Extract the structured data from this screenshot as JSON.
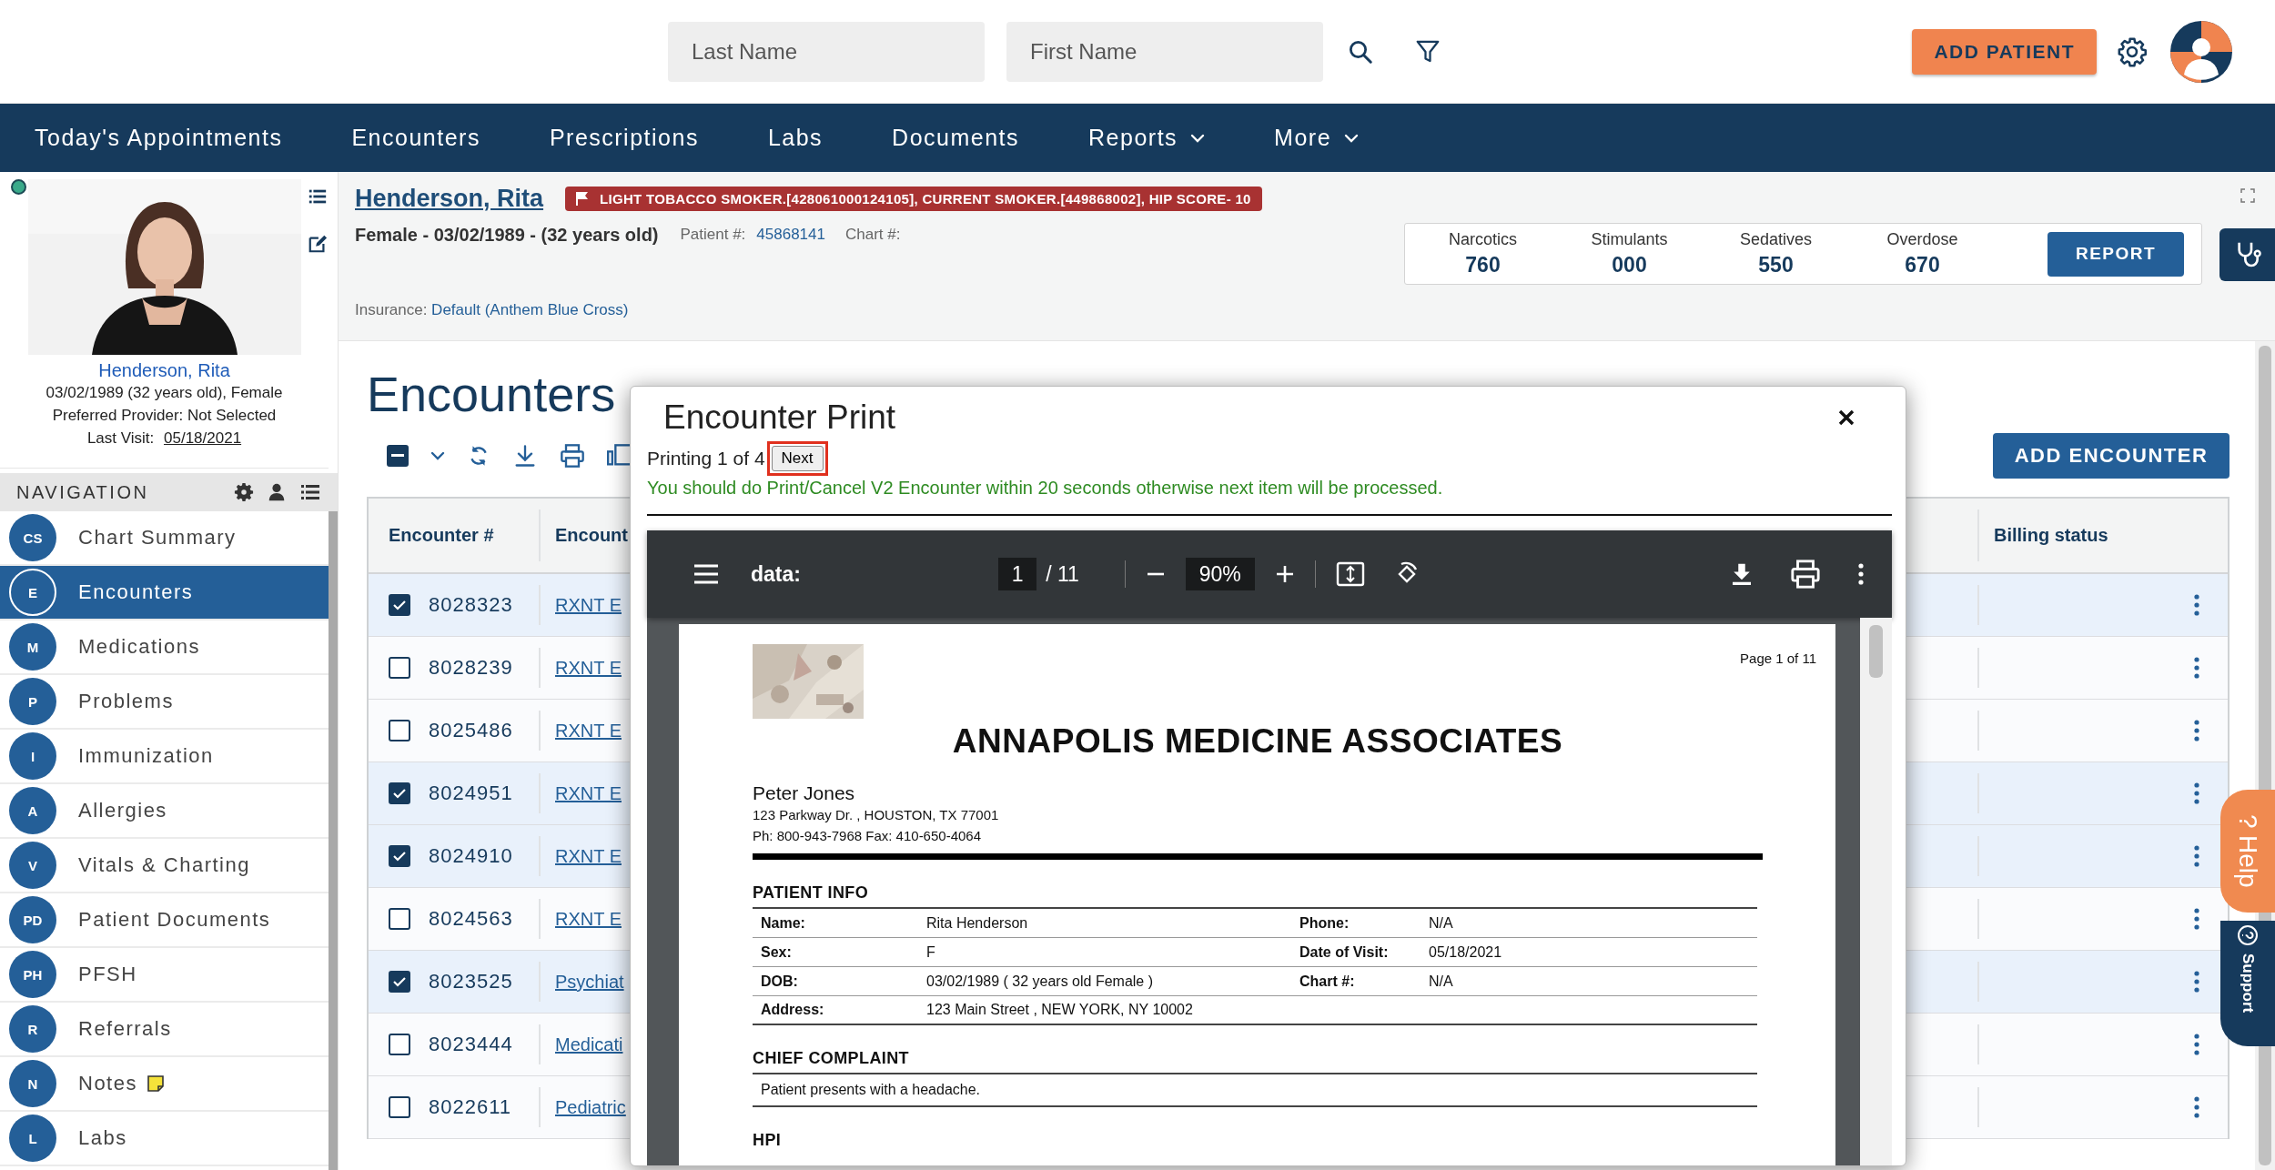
{
  "header": {
    "last_name": {
      "placeholder": "Last Name"
    },
    "first_name": {
      "placeholder": "First Name"
    },
    "add_patient": "ADD PATIENT"
  },
  "menu": [
    {
      "label": "Today's Appointments",
      "dropdown": false
    },
    {
      "label": "Encounters",
      "dropdown": false
    },
    {
      "label": "Prescriptions",
      "dropdown": false
    },
    {
      "label": "Labs",
      "dropdown": false
    },
    {
      "label": "Documents",
      "dropdown": false
    },
    {
      "label": "Reports",
      "dropdown": true
    },
    {
      "label": "More",
      "dropdown": true
    }
  ],
  "patient_card": {
    "name": "Henderson, Rita",
    "details": [
      "03/02/1989 (32 years old), Female",
      "Preferred Provider: Not Selected"
    ],
    "last_visit_label": "Last Visit:",
    "last_visit": "05/18/2021"
  },
  "navigation": {
    "title": "NAVIGATION",
    "items": [
      {
        "badge": "CS",
        "label": "Chart Summary",
        "selected": false
      },
      {
        "badge": "E",
        "label": "Encounters",
        "selected": true
      },
      {
        "badge": "M",
        "label": "Medications",
        "selected": false
      },
      {
        "badge": "P",
        "label": "Problems",
        "selected": false
      },
      {
        "badge": "I",
        "label": "Immunization",
        "selected": false
      },
      {
        "badge": "A",
        "label": "Allergies",
        "selected": false
      },
      {
        "badge": "V",
        "label": "Vitals & Charting",
        "selected": false
      },
      {
        "badge": "PD",
        "label": "Patient Documents",
        "selected": false
      },
      {
        "badge": "PH",
        "label": "PFSH",
        "selected": false
      },
      {
        "badge": "R",
        "label": "Referrals",
        "selected": false
      },
      {
        "badge": "N",
        "label": "Notes",
        "selected": false,
        "note": true
      },
      {
        "badge": "L",
        "label": "Labs",
        "selected": false
      }
    ]
  },
  "patient_banner": {
    "name": "Henderson, Rita",
    "alert": "LIGHT TOBACCO SMOKER.[428061000124105], CURRENT SMOKER.[449868002], HIP SCORE- 10",
    "summary": "Female - 03/02/1989 - (32 years old)",
    "patient_no_label": "Patient #:",
    "patient_no": "45868141",
    "chart_no_label": "Chart #:",
    "insurance_label": "Insurance:",
    "insurance": "Default (Anthem Blue Cross)",
    "stats": [
      {
        "label": "Narcotics",
        "value": "760"
      },
      {
        "label": "Stimulants",
        "value": "000"
      },
      {
        "label": "Sedatives",
        "value": "550"
      },
      {
        "label": "Overdose",
        "value": "670"
      }
    ],
    "report": "REPORT"
  },
  "encounters": {
    "title": "Encounters",
    "select_all_partial": true,
    "add": "ADD ENCOUNTER",
    "columns": [
      "Encounter #",
      "Encount",
      "Billing status"
    ],
    "rows": [
      {
        "number": "8028323",
        "name": "RXNT E",
        "checked": true
      },
      {
        "number": "8028239",
        "name": "RXNT E",
        "checked": false
      },
      {
        "number": "8025486",
        "name": "RXNT E",
        "checked": false
      },
      {
        "number": "8024951",
        "name": "RXNT E",
        "checked": true
      },
      {
        "number": "8024910",
        "name": "RXNT E",
        "checked": true
      },
      {
        "number": "8024563",
        "name": "RXNT E",
        "checked": false
      },
      {
        "number": "8023525",
        "name": "Psychiat",
        "checked": true
      },
      {
        "number": "8023444",
        "name": "Medicati",
        "checked": false
      },
      {
        "number": "8022611",
        "name": "Pediatric",
        "checked": false
      }
    ]
  },
  "print_dialog": {
    "title": "Encounter Print",
    "progress": "Printing 1 of 4",
    "next": "Next",
    "message": "You should do Print/Cancel V2 Encounter within 20 seconds otherwise next item will be processed.",
    "viewer": {
      "file": "data:",
      "page": "1",
      "pages": "/ 11",
      "zoom": "90%"
    },
    "document": {
      "page_label": "Page 1 of 11",
      "practice": "ANNAPOLIS MEDICINE ASSOCIATES",
      "provider": "Peter Jones",
      "address": "123 Parkway Dr. , HOUSTON, TX 77001",
      "contact": "Ph: 800-943-7968 Fax: 410-650-4064",
      "sections": [
        {
          "kind": "table",
          "title": "PATIENT INFO",
          "rows": [
            [
              "Name:",
              "Rita Henderson",
              "Phone:",
              "N/A"
            ],
            [
              "Sex:",
              "F",
              "Date of Visit:",
              "05/18/2021"
            ],
            [
              "DOB:",
              "03/02/1989 ( 32 years old Female )",
              "Chart #:",
              "N/A"
            ],
            [
              "Address:",
              "123 Main Street , NEW YORK, NY 10002"
            ]
          ]
        },
        {
          "kind": "text",
          "title": "CHIEF COMPLAINT",
          "text": "Patient presents with a headache."
        },
        {
          "kind": "heading",
          "title": "HPI"
        }
      ]
    }
  },
  "help": {
    "icon": "?",
    "label": "Help"
  },
  "support": {
    "label": "Support"
  }
}
